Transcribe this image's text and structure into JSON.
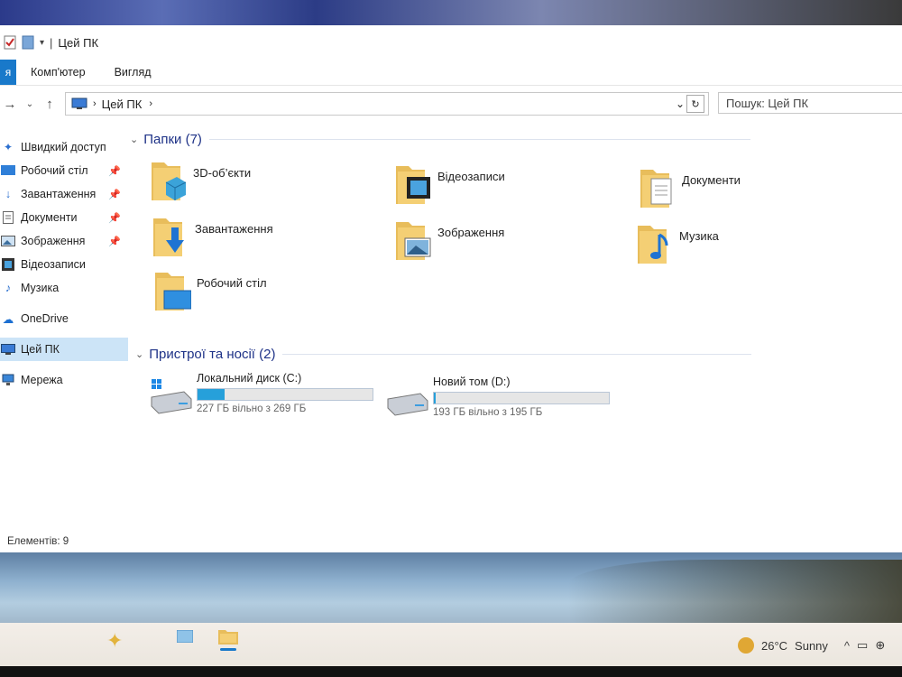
{
  "window": {
    "title": "Цей ПК",
    "ribbon_tabs": [
      "Комп'ютер",
      "Вигляд"
    ]
  },
  "address": {
    "path": "Цей ПК",
    "search_placeholder": "Пошук: Цей ПК"
  },
  "sidebar": {
    "quick_access": "Швидкий доступ",
    "items": [
      {
        "label": "Робочий стіл",
        "pinned": true
      },
      {
        "label": "Завантаження",
        "pinned": true
      },
      {
        "label": "Документи",
        "pinned": true
      },
      {
        "label": "Зображення",
        "pinned": true
      },
      {
        "label": "Відеозаписи",
        "pinned": false
      },
      {
        "label": "Музика",
        "pinned": false
      }
    ],
    "onedrive": "OneDrive",
    "this_pc": "Цей ПК",
    "network": "Мережа"
  },
  "folders_group": {
    "title": "Папки (7)",
    "items": [
      "3D-об’єкти",
      "Відеозаписи",
      "Документи",
      "Завантаження",
      "Зображення",
      "Музика",
      "Робочий стіл"
    ]
  },
  "devices_group": {
    "title": "Пристрої та носії (2)",
    "drives": [
      {
        "name": "Локальний диск (C:)",
        "free": "227 ГБ вільно з 269 ГБ",
        "used_fraction": 0.156
      },
      {
        "name": "Новий том (D:)",
        "free": "193 ГБ вільно з 195 ГБ",
        "used_fraction": 0.01
      }
    ]
  },
  "status": {
    "items": "Елементів: 9"
  },
  "taskbar": {
    "temperature": "26°C",
    "condition": "Sunny"
  },
  "colors": {
    "accent": "#1979ca",
    "header_text": "#1e3287",
    "drive_bar": "#26a0da",
    "folder": "#e8bd5b"
  }
}
